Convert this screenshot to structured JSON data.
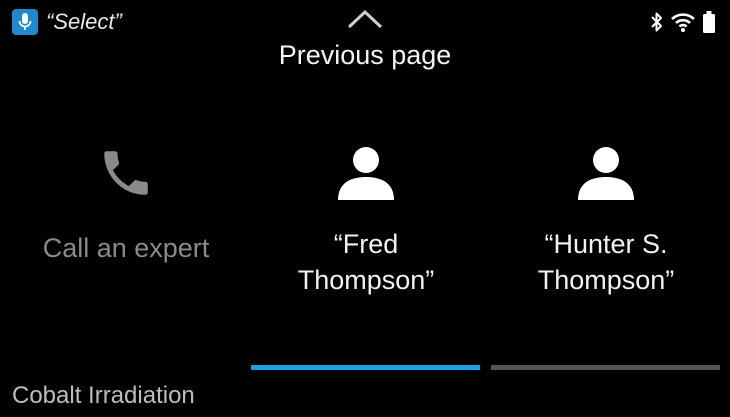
{
  "status_bar": {
    "voice_command": "“Select”",
    "mic_icon": "microphone-icon",
    "icons": [
      "bluetooth-icon",
      "wifi-icon",
      "battery-icon"
    ],
    "colors": {
      "mic_badge": "#1e88d0"
    }
  },
  "navigation": {
    "up_icon": "chevron-up-icon",
    "previous_label": "Previous page"
  },
  "cards": [
    {
      "label": "Call an expert",
      "icon": "phone-icon",
      "enabled": false
    },
    {
      "label": "“Fred\nThompson”",
      "icon": "person-icon",
      "enabled": true
    },
    {
      "label": "“Hunter S.\nThompson”",
      "icon": "person-icon",
      "enabled": true
    }
  ],
  "page_indicator": {
    "active_color": "#1aa1e6",
    "inactive_color": "#555555"
  },
  "footer": {
    "title": "Cobalt Irradiation"
  }
}
